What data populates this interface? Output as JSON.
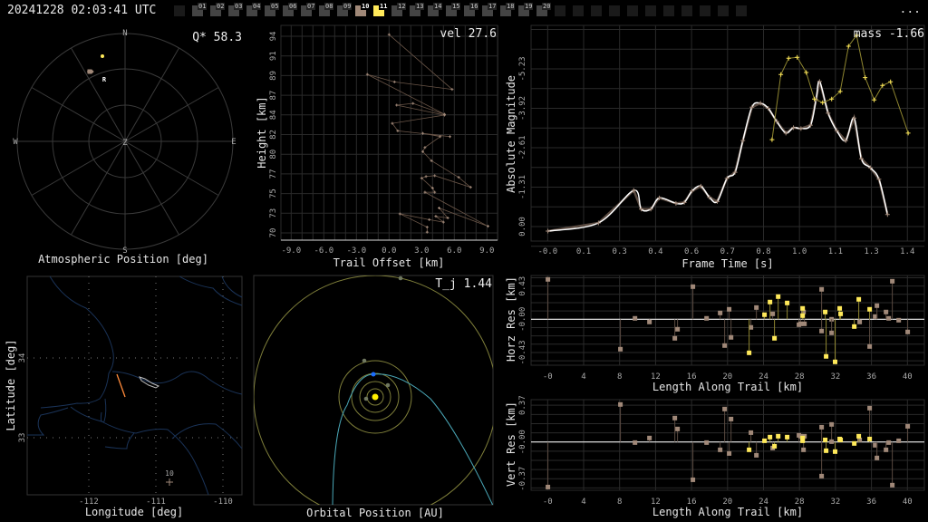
{
  "header": {
    "timestamp": "20241228 02:03:41 UTC",
    "menu_label": "...",
    "frames": [
      "01",
      "02",
      "03",
      "04",
      "05",
      "06",
      "07",
      "08",
      "09",
      "10",
      "11",
      "12",
      "13",
      "14",
      "15",
      "16",
      "17",
      "18",
      "19",
      "20"
    ],
    "highlighted_frame": "10",
    "selected_frame": "11"
  },
  "colors": {
    "accent_yellow": "#ffe95a",
    "station_brown": "#a08878",
    "earth_blue": "#1a6cff",
    "comet_cyan": "#4aa8b8",
    "river_blue": "#1a3358",
    "trail_orange": "#ff8a3a"
  },
  "polar": {
    "title": "Atmospheric Position [deg]",
    "stat": "Q* 58.3",
    "compass": {
      "n": "N",
      "e": "E",
      "s": "S",
      "w": "W",
      "z": "Z"
    },
    "radiant_label": "R"
  },
  "height_panel": {
    "stat": "vel 27.6",
    "xlabel": "Trail Offset [km]",
    "ylabel": "Height [km]"
  },
  "magnitude_panel": {
    "stat": "mass -1.66",
    "xlabel": "Frame Time [s]",
    "ylabel": "Absolute Magnitude"
  },
  "map": {
    "xlabel": "Longitude [deg]",
    "ylabel": "Latitude [deg]",
    "xticks": [
      "-112",
      "-111",
      "-110"
    ],
    "yticks": [
      "34",
      "33"
    ],
    "station_label": "10"
  },
  "orbit": {
    "title": "Orbital Position [AU]",
    "stat": "T_j 1.44"
  },
  "horz_panel": {
    "xlabel": "Length Along Trail [km]",
    "ylabel": "Horz Res [km]"
  },
  "vert_panel": {
    "xlabel": "Length Along Trail [km]",
    "ylabel": "Vert Res [km]"
  },
  "chart_data": [
    {
      "id": "height",
      "type": "scatter",
      "xlabel": "Trail Offset [km]",
      "ylabel": "Height [km]",
      "xticks": [
        {
          "value": -9,
          "label": "-9.0"
        },
        {
          "value": -6,
          "label": "-6.0"
        },
        {
          "value": -3,
          "label": "-3.0"
        },
        {
          "value": 0,
          "label": "0.0"
        },
        {
          "value": 3,
          "label": "3.0"
        },
        {
          "value": 6,
          "label": "6.0"
        },
        {
          "value": 9,
          "label": "9.0"
        }
      ],
      "yticks": [
        {
          "value": 94.0,
          "label": "94"
        },
        {
          "value": 91.63,
          "label": "91"
        },
        {
          "value": 89.26,
          "label": "89"
        },
        {
          "value": 86.89,
          "label": "87"
        },
        {
          "value": 84.52,
          "label": "84"
        },
        {
          "value": 82.15,
          "label": "82"
        },
        {
          "value": 79.78,
          "label": "80"
        },
        {
          "value": 77.41,
          "label": "77"
        },
        {
          "value": 75.04,
          "label": "75"
        },
        {
          "value": 72.67,
          "label": "73"
        },
        {
          "value": 70.3,
          "label": "70"
        }
      ],
      "xlim": [
        -9.9,
        10.0
      ],
      "ylim": [
        69.5,
        95.3
      ],
      "points": [
        [
          0.0,
          94.2
        ],
        [
          5.8,
          87.6
        ],
        [
          0.5,
          88.5
        ],
        [
          -2.0,
          89.4
        ],
        [
          5.1,
          84.6
        ],
        [
          2.2,
          85.9
        ],
        [
          0.7,
          85.7
        ],
        [
          5.1,
          84.5
        ],
        [
          0.3,
          83.5
        ],
        [
          0.8,
          82.6
        ],
        [
          5.6,
          81.9
        ],
        [
          3.1,
          82.3
        ],
        [
          4.7,
          81.9
        ],
        [
          3.3,
          80.6
        ],
        [
          3.1,
          80.1
        ],
        [
          3.9,
          79.0
        ],
        [
          6.4,
          77.0
        ],
        [
          7.5,
          75.8
        ],
        [
          4.2,
          77.2
        ],
        [
          3.4,
          77.1
        ],
        [
          3.0,
          76.9
        ],
        [
          4.0,
          75.7
        ],
        [
          4.2,
          75.2
        ],
        [
          3.3,
          75.2
        ],
        [
          9.1,
          71.1
        ],
        [
          4.6,
          73.3
        ],
        [
          5.4,
          72.1
        ],
        [
          4.3,
          72.3
        ],
        [
          5.0,
          71.6
        ],
        [
          3.7,
          71.9
        ],
        [
          1.0,
          72.6
        ],
        [
          3.5,
          71.0
        ],
        [
          3.5,
          70.4
        ]
      ]
    },
    {
      "id": "magnitude",
      "type": "line",
      "xlabel": "Frame Time [s]",
      "ylabel": "Absolute Magnitude",
      "xticks": [
        {
          "value": 0.0,
          "label": "-0.0"
        },
        {
          "value": 0.143,
          "label": "0.1"
        },
        {
          "value": 0.286,
          "label": "0.3"
        },
        {
          "value": 0.429,
          "label": "0.4"
        },
        {
          "value": 0.572,
          "label": "0.6"
        },
        {
          "value": 0.715,
          "label": "0.7"
        },
        {
          "value": 0.858,
          "label": "0.8"
        },
        {
          "value": 1.001,
          "label": "1.0"
        },
        {
          "value": 1.144,
          "label": "1.1"
        },
        {
          "value": 1.287,
          "label": "1.3"
        },
        {
          "value": 1.43,
          "label": "1.4"
        }
      ],
      "yticks": [
        {
          "value": 0.0,
          "label": "0.00"
        },
        {
          "value": -1.307,
          "label": "-1.31"
        },
        {
          "value": -2.614,
          "label": "-2.61"
        },
        {
          "value": -3.921,
          "label": "-3.92"
        },
        {
          "value": -5.228,
          "label": "-5.23"
        }
      ],
      "ylim_inverted": true,
      "series": [
        {
          "name": "station",
          "color": "#a08878",
          "x": [
            0.001,
            0.202,
            0.342,
            0.372,
            0.41,
            0.444,
            0.51,
            0.543,
            0.574,
            0.609,
            0.643,
            0.674,
            0.713,
            0.745,
            0.776,
            0.812,
            0.846,
            0.877,
            0.911,
            0.947,
            0.977,
            1.007,
            1.045,
            1.067,
            1.081,
            1.115,
            1.149,
            1.185,
            1.218,
            1.247,
            1.283,
            1.317,
            1.351
          ],
          "y": [
            0.15,
            -0.12,
            -1.2,
            -0.58,
            -0.58,
            -0.95,
            -0.77,
            -0.8,
            -1.18,
            -1.34,
            -0.97,
            -0.83,
            -1.6,
            -1.8,
            -2.85,
            -3.96,
            -4.09,
            -3.92,
            -3.48,
            -3.1,
            -3.28,
            -3.25,
            -3.36,
            -4.21,
            -4.81,
            -3.76,
            -3.18,
            -2.85,
            -3.6,
            -2.25,
            -1.95,
            -1.57,
            -0.4
          ]
        },
        {
          "name": "selected",
          "color": "#ffe95a",
          "x": [
            0.892,
            0.927,
            0.958,
            0.992,
            1.028,
            1.06,
            1.093,
            1.129,
            1.163,
            1.196,
            1.228,
            1.262,
            1.298,
            1.331,
            1.363,
            1.433
          ],
          "y": [
            -2.88,
            -5.04,
            -5.58,
            -5.61,
            -5.11,
            -4.23,
            -4.11,
            -4.23,
            -4.48,
            -5.98,
            -6.34,
            -4.94,
            -4.2,
            -4.68,
            -4.8,
            -3.1
          ]
        }
      ]
    },
    {
      "id": "horz_res",
      "type": "scatter",
      "xlabel": "Length Along Trail [km]",
      "ylabel": "Horz Res [km]",
      "xticks": [
        {
          "value": 0,
          "label": "-0"
        },
        {
          "value": 4,
          "label": "4"
        },
        {
          "value": 8,
          "label": "8"
        },
        {
          "value": 12,
          "label": "12"
        },
        {
          "value": 16,
          "label": "16"
        },
        {
          "value": 20,
          "label": "20"
        },
        {
          "value": 24,
          "label": "24"
        },
        {
          "value": 28,
          "label": "28"
        },
        {
          "value": 32,
          "label": "32"
        },
        {
          "value": 36,
          "label": "36"
        },
        {
          "value": 40,
          "label": "40"
        }
      ],
      "yticks": [
        {
          "value": 0.43,
          "label": "0.43"
        },
        {
          "value": 0.0,
          "label": "-0.00"
        },
        {
          "value": -0.43,
          "label": "-0.43"
        }
      ],
      "series": [
        {
          "name": "station",
          "color": "#a08878",
          "x": [
            0.03,
            8.09,
            9.71,
            11.32,
            14.14,
            14.44,
            16.15,
            17.67,
            19.18,
            19.68,
            20.18,
            20.39,
            22.6,
            23.21,
            25.02,
            27.94,
            28.14,
            28.45,
            28.55,
            30.46,
            30.46,
            31.57,
            31.57,
            34.69,
            35.8,
            36.41,
            36.61,
            37.62,
            37.92,
            38.32,
            39.03,
            40.03
          ],
          "y": [
            0.516,
            -0.387,
            0.012,
            -0.035,
            -0.246,
            -0.129,
            0.422,
            0.012,
            0.082,
            -0.34,
            0.129,
            -0.234,
            -0.105,
            0.152,
            0.07,
            -0.07,
            -0.059,
            0.094,
            -0.059,
            0.387,
            -0.152,
            0.0,
            -0.176,
            -0.035,
            -0.352,
            0.035,
            0.176,
            0.094,
            0.012,
            0.492,
            -0.012,
            -0.164
          ]
        },
        {
          "name": "selected",
          "color": "#ffe95a",
          "x": [
            22.4,
            24.11,
            24.72,
            25.22,
            25.63,
            26.63,
            28.35,
            28.35,
            30.86,
            30.96,
            31.96,
            32.47,
            32.57,
            34.09,
            34.59,
            35.8
          ],
          "y": [
            -0.434,
            0.059,
            0.223,
            -0.246,
            0.293,
            0.211,
            0.141,
            0.047,
            0.094,
            -0.48,
            -0.551,
            0.141,
            0.07,
            -0.094,
            0.258,
            0.129
          ]
        }
      ]
    },
    {
      "id": "vert_res",
      "type": "scatter",
      "xlabel": "Length Along Trail [km]",
      "ylabel": "Vert Res [km]",
      "xticks": [
        {
          "value": 0,
          "label": "-0"
        },
        {
          "value": 4,
          "label": "4"
        },
        {
          "value": 8,
          "label": "8"
        },
        {
          "value": 12,
          "label": "12"
        },
        {
          "value": 16,
          "label": "16"
        },
        {
          "value": 20,
          "label": "20"
        },
        {
          "value": 24,
          "label": "24"
        },
        {
          "value": 28,
          "label": "28"
        },
        {
          "value": 32,
          "label": "32"
        },
        {
          "value": 36,
          "label": "36"
        },
        {
          "value": 40,
          "label": "40"
        }
      ],
      "yticks": [
        {
          "value": 0.37,
          "label": "0.37"
        },
        {
          "value": 0.0,
          "label": "-0.00"
        },
        {
          "value": -0.37,
          "label": "-0.37"
        }
      ],
      "series": [
        {
          "name": "station",
          "color": "#a08878",
          "x": [
            0.03,
            8.09,
            9.71,
            11.32,
            14.14,
            14.44,
            16.15,
            17.67,
            19.18,
            19.68,
            20.18,
            20.39,
            22.6,
            23.21,
            25.02,
            27.94,
            28.14,
            28.45,
            28.55,
            30.46,
            30.46,
            31.57,
            31.57,
            34.69,
            35.8,
            36.41,
            36.61,
            37.62,
            37.92,
            38.32,
            39.03,
            40.03
          ],
          "y": [
            -0.454,
            0.378,
            -0.006,
            0.04,
            0.241,
            0.131,
            -0.381,
            -0.006,
            -0.079,
            0.332,
            -0.116,
            0.231,
            0.094,
            -0.134,
            -0.061,
            0.067,
            0.058,
            -0.079,
            0.058,
            0.149,
            -0.344,
            0.177,
            0.003,
            0.021,
            0.341,
            -0.033,
            -0.161,
            -0.079,
            -0.006,
            -0.435,
            0.012,
            0.158
          ]
        },
        {
          "name": "selected",
          "color": "#ffe95a",
          "x": [
            22.4,
            24.11,
            24.72,
            25.22,
            25.63,
            26.63,
            28.35,
            28.35,
            30.86,
            30.96,
            31.96,
            32.47,
            32.57,
            34.09,
            34.59,
            35.8
          ],
          "y": [
            -0.079,
            0.012,
            0.049,
            -0.043,
            0.058,
            0.049,
            0.04,
            0.012,
            0.021,
            -0.088,
            -0.097,
            0.03,
            0.021,
            -0.015,
            0.058,
            0.03
          ]
        }
      ]
    }
  ]
}
